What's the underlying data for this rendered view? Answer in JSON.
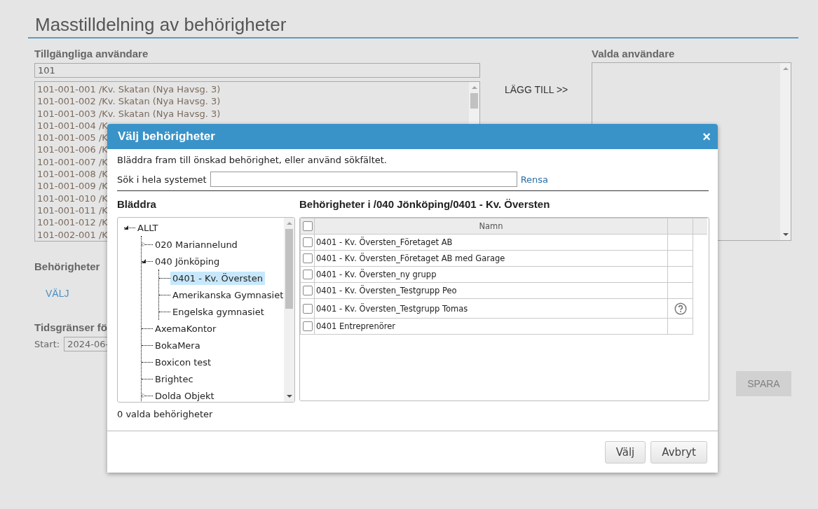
{
  "page": {
    "title": "Masstilldelning av behörigheter"
  },
  "available": {
    "label": "Tillgängliga användare",
    "filter_value": "101",
    "users": [
      "101-001-001 /Kv. Skatan (Nya Havsg. 3)",
      "101-001-002 /Kv. Skatan (Nya Havsg. 3)",
      "101-001-003 /Kv. Skatan (Nya Havsg. 3)",
      "101-001-004 /K",
      "101-001-005 /K",
      "101-001-006 /K",
      "101-001-007 /K",
      "101-001-008 /K",
      "101-001-009 /K",
      "101-001-010 /K",
      "101-001-011 /K",
      "101-001-012 /K",
      "101-002-001 /K"
    ]
  },
  "add_link": "LÄGG TILL >>",
  "selected_users": {
    "label": "Valda användare"
  },
  "permissions": {
    "label": "Behörigheter",
    "choose_link": "VÄLJ"
  },
  "time_limits": {
    "label": "Tidsgränser fö",
    "start_label": "Start:",
    "start_value": "2024-06-"
  },
  "save_button": {
    "label": "SPARA",
    "disabled": true
  },
  "dialog": {
    "title": "Välj behörigheter",
    "close": "×",
    "hint": "Bläddra fram till önskad behörighet, eller använd sökfältet.",
    "search_label": "Sök i hela systemet",
    "clear_link": "Rensa",
    "browse_heading": "Bläddra",
    "tree": [
      {
        "label": "ALLT",
        "expanded": true,
        "selected": false,
        "children": [
          {
            "label": "020 Mariannelund",
            "expanded": false,
            "selected": false
          },
          {
            "label": "040 Jönköping",
            "expanded": true,
            "selected": false,
            "children": [
              {
                "label": "0401 - Kv. Översten",
                "selected": true
              },
              {
                "label": "Amerikanska Gymnasiet",
                "selected": false
              },
              {
                "label": "Engelska gymnasiet",
                "selected": false
              }
            ]
          },
          {
            "label": "AxemaKontor",
            "selected": false
          },
          {
            "label": "BokaMera",
            "selected": false
          },
          {
            "label": "Boxicon test",
            "selected": false
          },
          {
            "label": "Brightec",
            "selected": false
          },
          {
            "label": "Dolda Objekt",
            "expanded": false,
            "selected": false
          }
        ]
      }
    ],
    "grid_heading": "Behörigheter i /040 Jönköping/0401 - Kv. Översten",
    "grid": {
      "all_checked": false,
      "column": "Namn",
      "rows": [
        {
          "name": "0401 - Kv. Översten_Företaget AB",
          "checked": false,
          "help": false
        },
        {
          "name": "0401 - Kv. Översten_Företaget AB med Garage",
          "checked": false,
          "help": false
        },
        {
          "name": "0401 - Kv. Översten_ny grupp",
          "checked": false,
          "help": false
        },
        {
          "name": "0401 - Kv. Översten_Testgrupp Peo",
          "checked": false,
          "help": false
        },
        {
          "name": "0401 - Kv. Översten_Testgrupp Tomas",
          "checked": false,
          "help": true
        },
        {
          "name": "0401 Entreprenörer",
          "checked": false,
          "help": false
        }
      ]
    },
    "count_text": "0 valda behörigheter",
    "buttons": [
      "Välj",
      "Avbryt"
    ]
  }
}
